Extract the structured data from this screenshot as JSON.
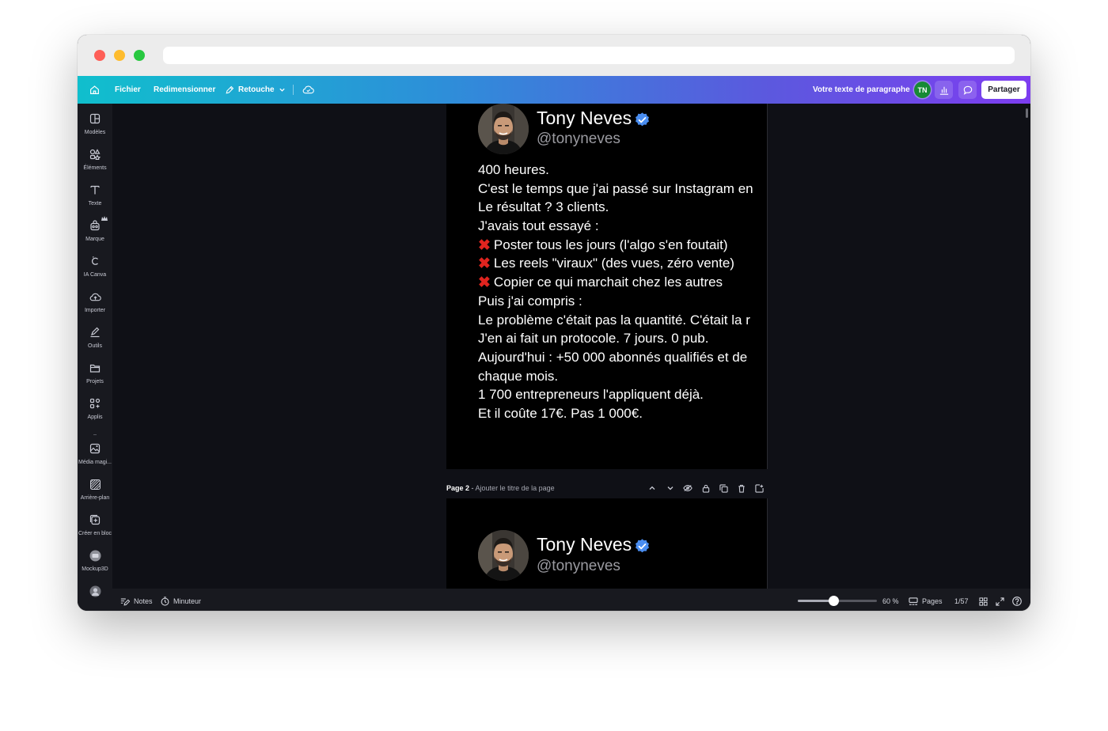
{
  "toolbar": {
    "file": "Fichier",
    "resize": "Redimensionner",
    "edit": "Retouche",
    "doc_title": "Votre texte de paragraphe",
    "avatar_initials": "TN",
    "share": "Partager"
  },
  "sidebar": {
    "items": [
      {
        "label": "Modèles",
        "icon": "layout-icon"
      },
      {
        "label": "Éléments",
        "icon": "shapes-icon"
      },
      {
        "label": "Texte",
        "icon": "text-icon"
      },
      {
        "label": "Marque",
        "icon": "brand-icon"
      },
      {
        "label": "IA Canva",
        "icon": "ai-icon"
      },
      {
        "label": "Importer",
        "icon": "upload-cloud-icon"
      },
      {
        "label": "Outils",
        "icon": "draw-tool-icon"
      },
      {
        "label": "Projets",
        "icon": "folder-icon"
      },
      {
        "label": "Applis",
        "icon": "apps-icon"
      },
      {
        "label": "Média magi...",
        "icon": "magic-media-icon"
      },
      {
        "label": "Arrière-plan",
        "icon": "background-icon"
      },
      {
        "label": "Créer en bloc",
        "icon": "bulk-create-icon"
      },
      {
        "label": "Mockup3D",
        "icon": "mockup-icon"
      }
    ]
  },
  "pages": [
    {
      "name": "Tony Neves",
      "handle": "@tonyneves",
      "lines": [
        {
          "text": "400 heures.",
          "x": false
        },
        {
          "text": "C'est le temps que j'ai passé sur Instagram en",
          "x": false
        },
        {
          "text": " Le résultat ? 3 clients.",
          "x": false
        },
        {
          "text": "J'avais tout essayé :",
          "x": false
        },
        {
          "text": "Poster tous les jours (l'algo s'en foutait)",
          "x": true
        },
        {
          "text": "Les reels \"viraux\" (des vues, zéro vente)",
          "x": true
        },
        {
          "text": "Copier ce qui marchait chez les autres",
          "x": true
        },
        {
          "text": "Puis j'ai compris :",
          "x": false
        },
        {
          "text": " Le problème c'était pas la quantité. C'était la r",
          "x": false
        },
        {
          "text": "J'en ai fait un protocole. 7 jours. 0 pub.",
          "x": false
        },
        {
          "text": " Aujourd'hui : +50 000 abonnés qualifiés et de",
          "x": false
        },
        {
          "text": "chaque mois.",
          "x": false
        },
        {
          "text": "1 700 entrepreneurs l'appliquent déjà.",
          "x": false
        },
        {
          "text": " Et il coûte 17€. Pas 1 000€.",
          "x": false
        }
      ]
    },
    {
      "name": "Tony Neves",
      "handle": "@tonyneves"
    }
  ],
  "page_bar": {
    "label": "Page 2",
    "separator": " - ",
    "title_placeholder": "Ajouter le titre de la page"
  },
  "bottombar": {
    "notes": "Notes",
    "timer": "Minuteur",
    "zoom": "60 %",
    "zoom_level": 0.45,
    "pages": "Pages",
    "page_count": "1/57"
  }
}
